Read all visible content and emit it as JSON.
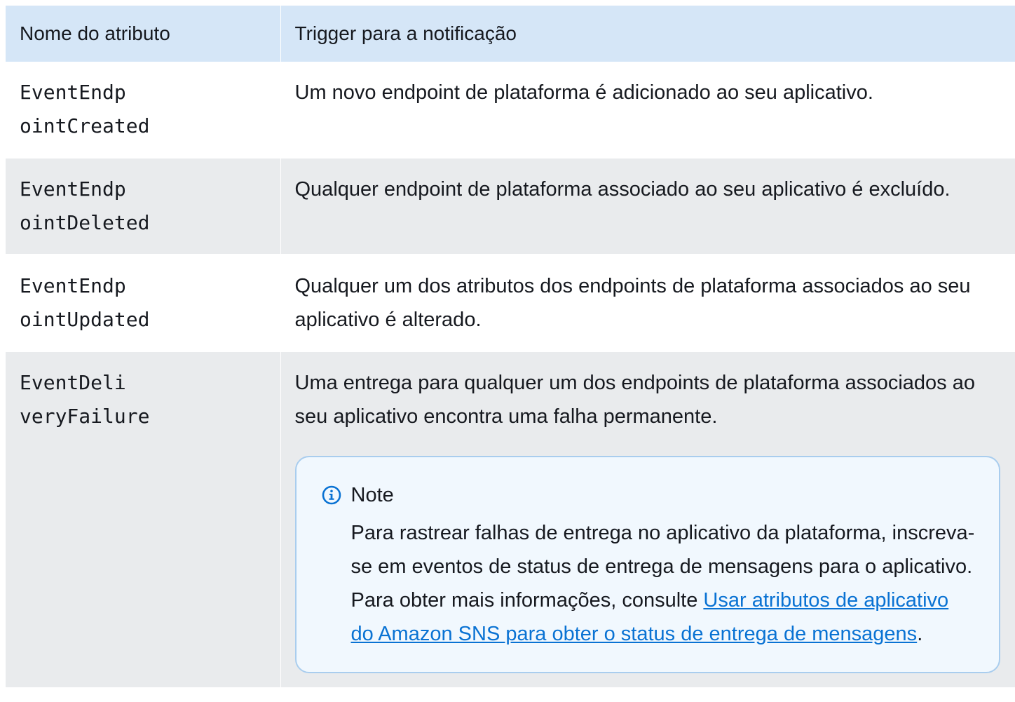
{
  "table": {
    "headers": [
      "Nome do atributo",
      "Trigger para a notificação"
    ],
    "rows": [
      {
        "name_l1": "EventEndp",
        "name_l2": "ointCreated",
        "desc": "Um novo endpoint de plataforma é adicionado ao seu aplicativo."
      },
      {
        "name_l1": "EventEndp",
        "name_l2": "ointDeleted",
        "desc": "Qualquer endpoint de plataforma associado ao seu aplicativo é excluído."
      },
      {
        "name_l1": "EventEndp",
        "name_l2": "ointUpdated",
        "desc": "Qualquer um dos atributos dos endpoints de plataforma associados ao seu aplicativo é alterado."
      },
      {
        "name_l1": "EventDeli",
        "name_l2": "veryFailure",
        "desc": "Uma entrega para qualquer um dos endpoints de plataforma associados ao seu aplicativo encontra uma falha permanente."
      }
    ]
  },
  "note": {
    "title": "Note",
    "icon": "info-icon",
    "text_before": "Para rastrear falhas de entrega no aplicativo da plataforma, inscreva-se em eventos de status de entrega de mensagens para o aplicativo. Para obter mais informações, consulte ",
    "link_text": "Usar atributos de aplicativo do Amazon SNS para obter o status de entrega de mensagens",
    "text_after": "."
  },
  "colors": {
    "header_bg": "#d5e6f7",
    "row_alt_bg": "#e9ebed",
    "note_bg": "#f1f8fe",
    "note_border": "#a9cdee",
    "link": "#0972d3"
  }
}
